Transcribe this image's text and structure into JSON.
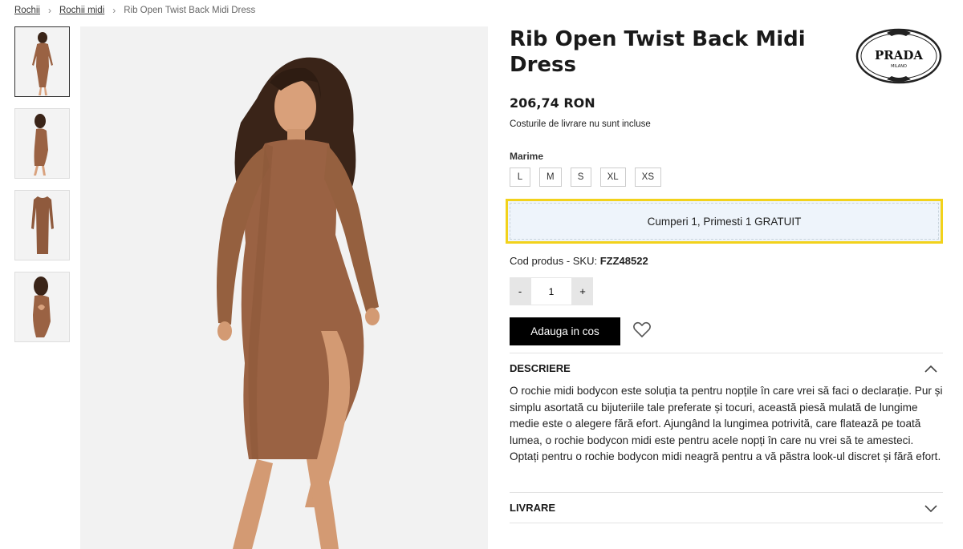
{
  "breadcrumb": {
    "items": [
      "Rochii",
      "Rochii midi"
    ],
    "current": "Rib Open Twist Back Midi Dress",
    "separator": ">"
  },
  "gallery": {
    "thumbnails": [
      "front-view",
      "side-view",
      "flat-view",
      "back-view"
    ],
    "active_index": 0
  },
  "product": {
    "title": "Rib Open Twist Back Midi Dress",
    "brand": "PRADA",
    "brand_sub": "MILANO",
    "price": "206,74 RON",
    "shipping_note": "Costurile de livrare nu sunt incluse",
    "size_label": "Marime",
    "sizes": [
      "L",
      "M",
      "S",
      "XL",
      "XS"
    ],
    "promo": "Cumperi 1, Primesti 1 GRATUIT",
    "sku_label": "Cod produs - SKU:",
    "sku_value": "FZZ48522",
    "qty_minus": "-",
    "qty_value": "1",
    "qty_plus": "+",
    "add_to_cart": "Adauga in cos"
  },
  "accordion": {
    "description_title": "DESCRIERE",
    "description_text": "O rochie midi bodycon este soluția ta pentru nopțile în care vrei să faci o declarație. Pur și simplu asortată cu bijuteriile tale preferate și tocuri, această piesă mulată de lungime medie este o alegere fără efort. Ajungând la lungimea potrivită, care flatează pe toată lumea, o rochie bodycon midi este pentru acele nopți în care nu vrei să te amesteci. Optați pentru o rochie bodycon midi neagră pentru a vă păstra look-ul discret și fără efort.",
    "delivery_title": "LIVRARE"
  },
  "colors": {
    "promo_border": "#f2d21b",
    "promo_bg": "#eef4fb",
    "button_bg": "#000000",
    "dress": "#9a6243"
  },
  "icons": [
    "chevron-right-icon",
    "heart-icon",
    "chevron-up-icon",
    "chevron-down-icon"
  ]
}
